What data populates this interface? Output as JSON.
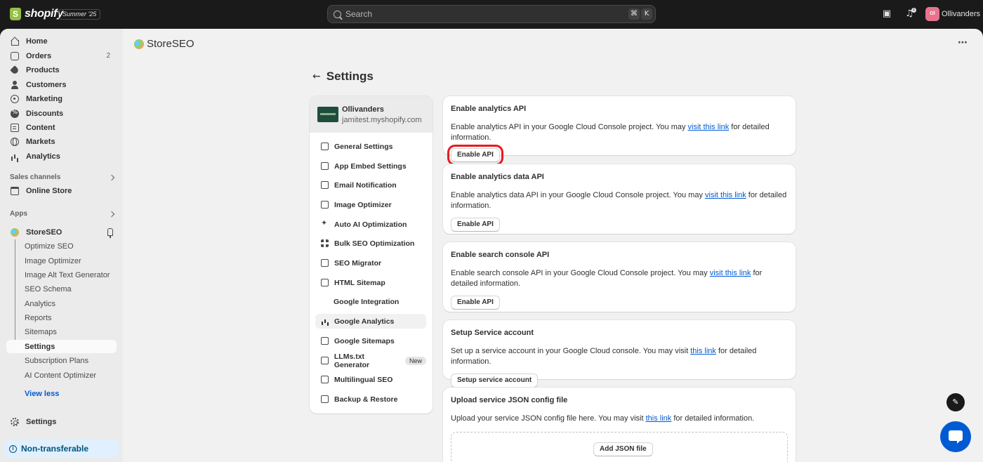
{
  "topbar": {
    "brand": "shopify",
    "edition": "Summer '25",
    "search_placeholder": "Search",
    "shortcut_keys": [
      "⌘",
      "K"
    ],
    "notification_count": "1",
    "avatar_initials": "Ol",
    "store_name": "Ollivanders"
  },
  "sidebar": {
    "items": [
      {
        "label": "Home",
        "icon": "home-icon"
      },
      {
        "label": "Orders",
        "icon": "inbox-icon",
        "count": "2"
      },
      {
        "label": "Products",
        "icon": "tag-icon"
      },
      {
        "label": "Customers",
        "icon": "person-icon"
      },
      {
        "label": "Marketing",
        "icon": "target-icon"
      },
      {
        "label": "Discounts",
        "icon": "discount-icon"
      },
      {
        "label": "Content",
        "icon": "document-icon"
      },
      {
        "label": "Markets",
        "icon": "globe-icon"
      },
      {
        "label": "Analytics",
        "icon": "bar-chart-icon"
      }
    ],
    "sales_channels_label": "Sales channels",
    "online_store_label": "Online Store",
    "apps_label": "Apps",
    "app_name": "StoreSEO",
    "app_subitems": [
      "Optimize SEO",
      "Image Optimizer",
      "Image Alt Text Generator",
      "SEO Schema",
      "Analytics",
      "Reports",
      "Sitemaps",
      "Settings",
      "Subscription Plans",
      "AI Content Optimizer"
    ],
    "view_less": "View less",
    "settings_label": "Settings",
    "non_transferable": "Non-transferable"
  },
  "main": {
    "app_title": "StoreSEO",
    "page_title": "Settings",
    "store": {
      "name": "Ollivanders",
      "domain": "jamitest.myshopify.com"
    },
    "menu": [
      {
        "label": "General Settings"
      },
      {
        "label": "App Embed Settings"
      },
      {
        "label": "Email Notification"
      },
      {
        "label": "Image Optimizer"
      },
      {
        "label": "Auto AI Optimization"
      },
      {
        "label": "Bulk SEO Optimization"
      },
      {
        "label": "SEO Migrator"
      },
      {
        "label": "HTML Sitemap"
      },
      {
        "label": "Google Integration"
      },
      {
        "label": "Google Analytics"
      },
      {
        "label": "Google Sitemaps"
      },
      {
        "label": "LLMs.txt Generator",
        "badge": "New"
      },
      {
        "label": "Multilingual SEO"
      },
      {
        "label": "Backup & Restore"
      }
    ],
    "cards": [
      {
        "title": "Enable analytics API",
        "text_before": "Enable analytics API in your Google Cloud Console project. You may ",
        "link": "visit this link",
        "text_after": " for detailed information.",
        "button": "Enable API"
      },
      {
        "title": "Enable analytics data API",
        "text_before": "Enable analytics data API in your Google Cloud Console project. You may ",
        "link": "visit this link",
        "text_after": " for detailed information.",
        "button": "Enable API"
      },
      {
        "title": "Enable search console API",
        "text_before": "Enable search console API in your Google Cloud Console project. You may ",
        "link": "visit this link",
        "text_after": " for detailed information.",
        "button": "Enable API"
      },
      {
        "title": "Setup Service account",
        "text_before": "Set up a service account in your Google Cloud console. You may visit ",
        "link": "this link",
        "text_after": " for detailed information.",
        "button": "Setup service account"
      },
      {
        "title": "Upload service JSON config file",
        "text_before": "Upload your service JSON config file here. You may visit ",
        "link": "this link",
        "text_after": " for detailed information.",
        "button": "Add JSON file"
      }
    ]
  },
  "colors": {
    "accent": "#005bd3",
    "highlight": "#e51c23",
    "topbar": "#1a1a1a"
  }
}
